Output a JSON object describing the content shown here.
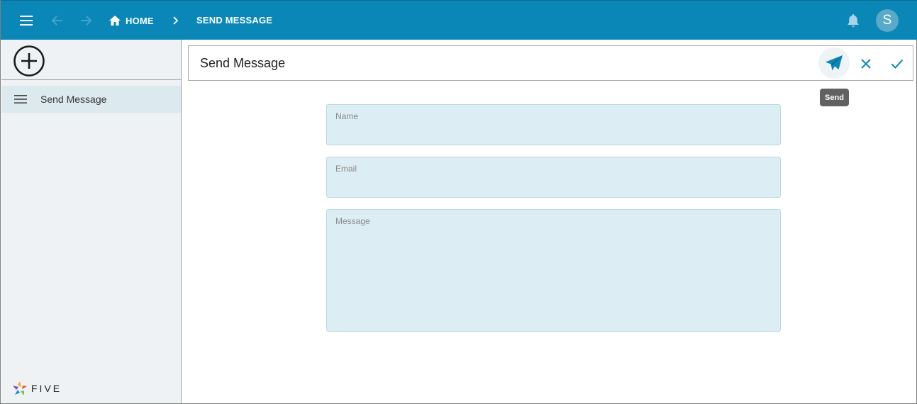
{
  "topbar": {
    "menu_icon": "hamburger-menu-icon",
    "back_icon": "arrow-left-icon",
    "forward_icon": "arrow-right-icon",
    "breadcrumb": {
      "home_label": "HOME",
      "separator_icon": "chevron-right-icon",
      "current_label": "SEND MESSAGE"
    },
    "notifications_icon": "bell-icon",
    "avatar_letter": "S"
  },
  "sidebar": {
    "add_icon": "plus-circle-icon",
    "items": [
      {
        "label": "Send Message",
        "icon": "list-lines-icon"
      }
    ],
    "logo_text": "FIVE"
  },
  "form": {
    "title": "Send Message",
    "actions": {
      "send_icon": "paper-plane-icon",
      "cancel_icon": "close-icon",
      "confirm_icon": "check-icon",
      "send_tooltip": "Send"
    },
    "fields": {
      "name": {
        "label": "Name",
        "value": ""
      },
      "email": {
        "label": "Email",
        "value": ""
      },
      "message": {
        "label": "Message",
        "value": ""
      }
    }
  },
  "colors": {
    "topbar_bg": "#0b87b7",
    "accent": "#0b87b7",
    "sidebar_bg": "#eef2f4",
    "sidebar_selected_bg": "#dce9ee",
    "field_bg": "#dcedf3",
    "tooltip_bg": "#616161",
    "avatar_bg": "#59a9c9"
  }
}
